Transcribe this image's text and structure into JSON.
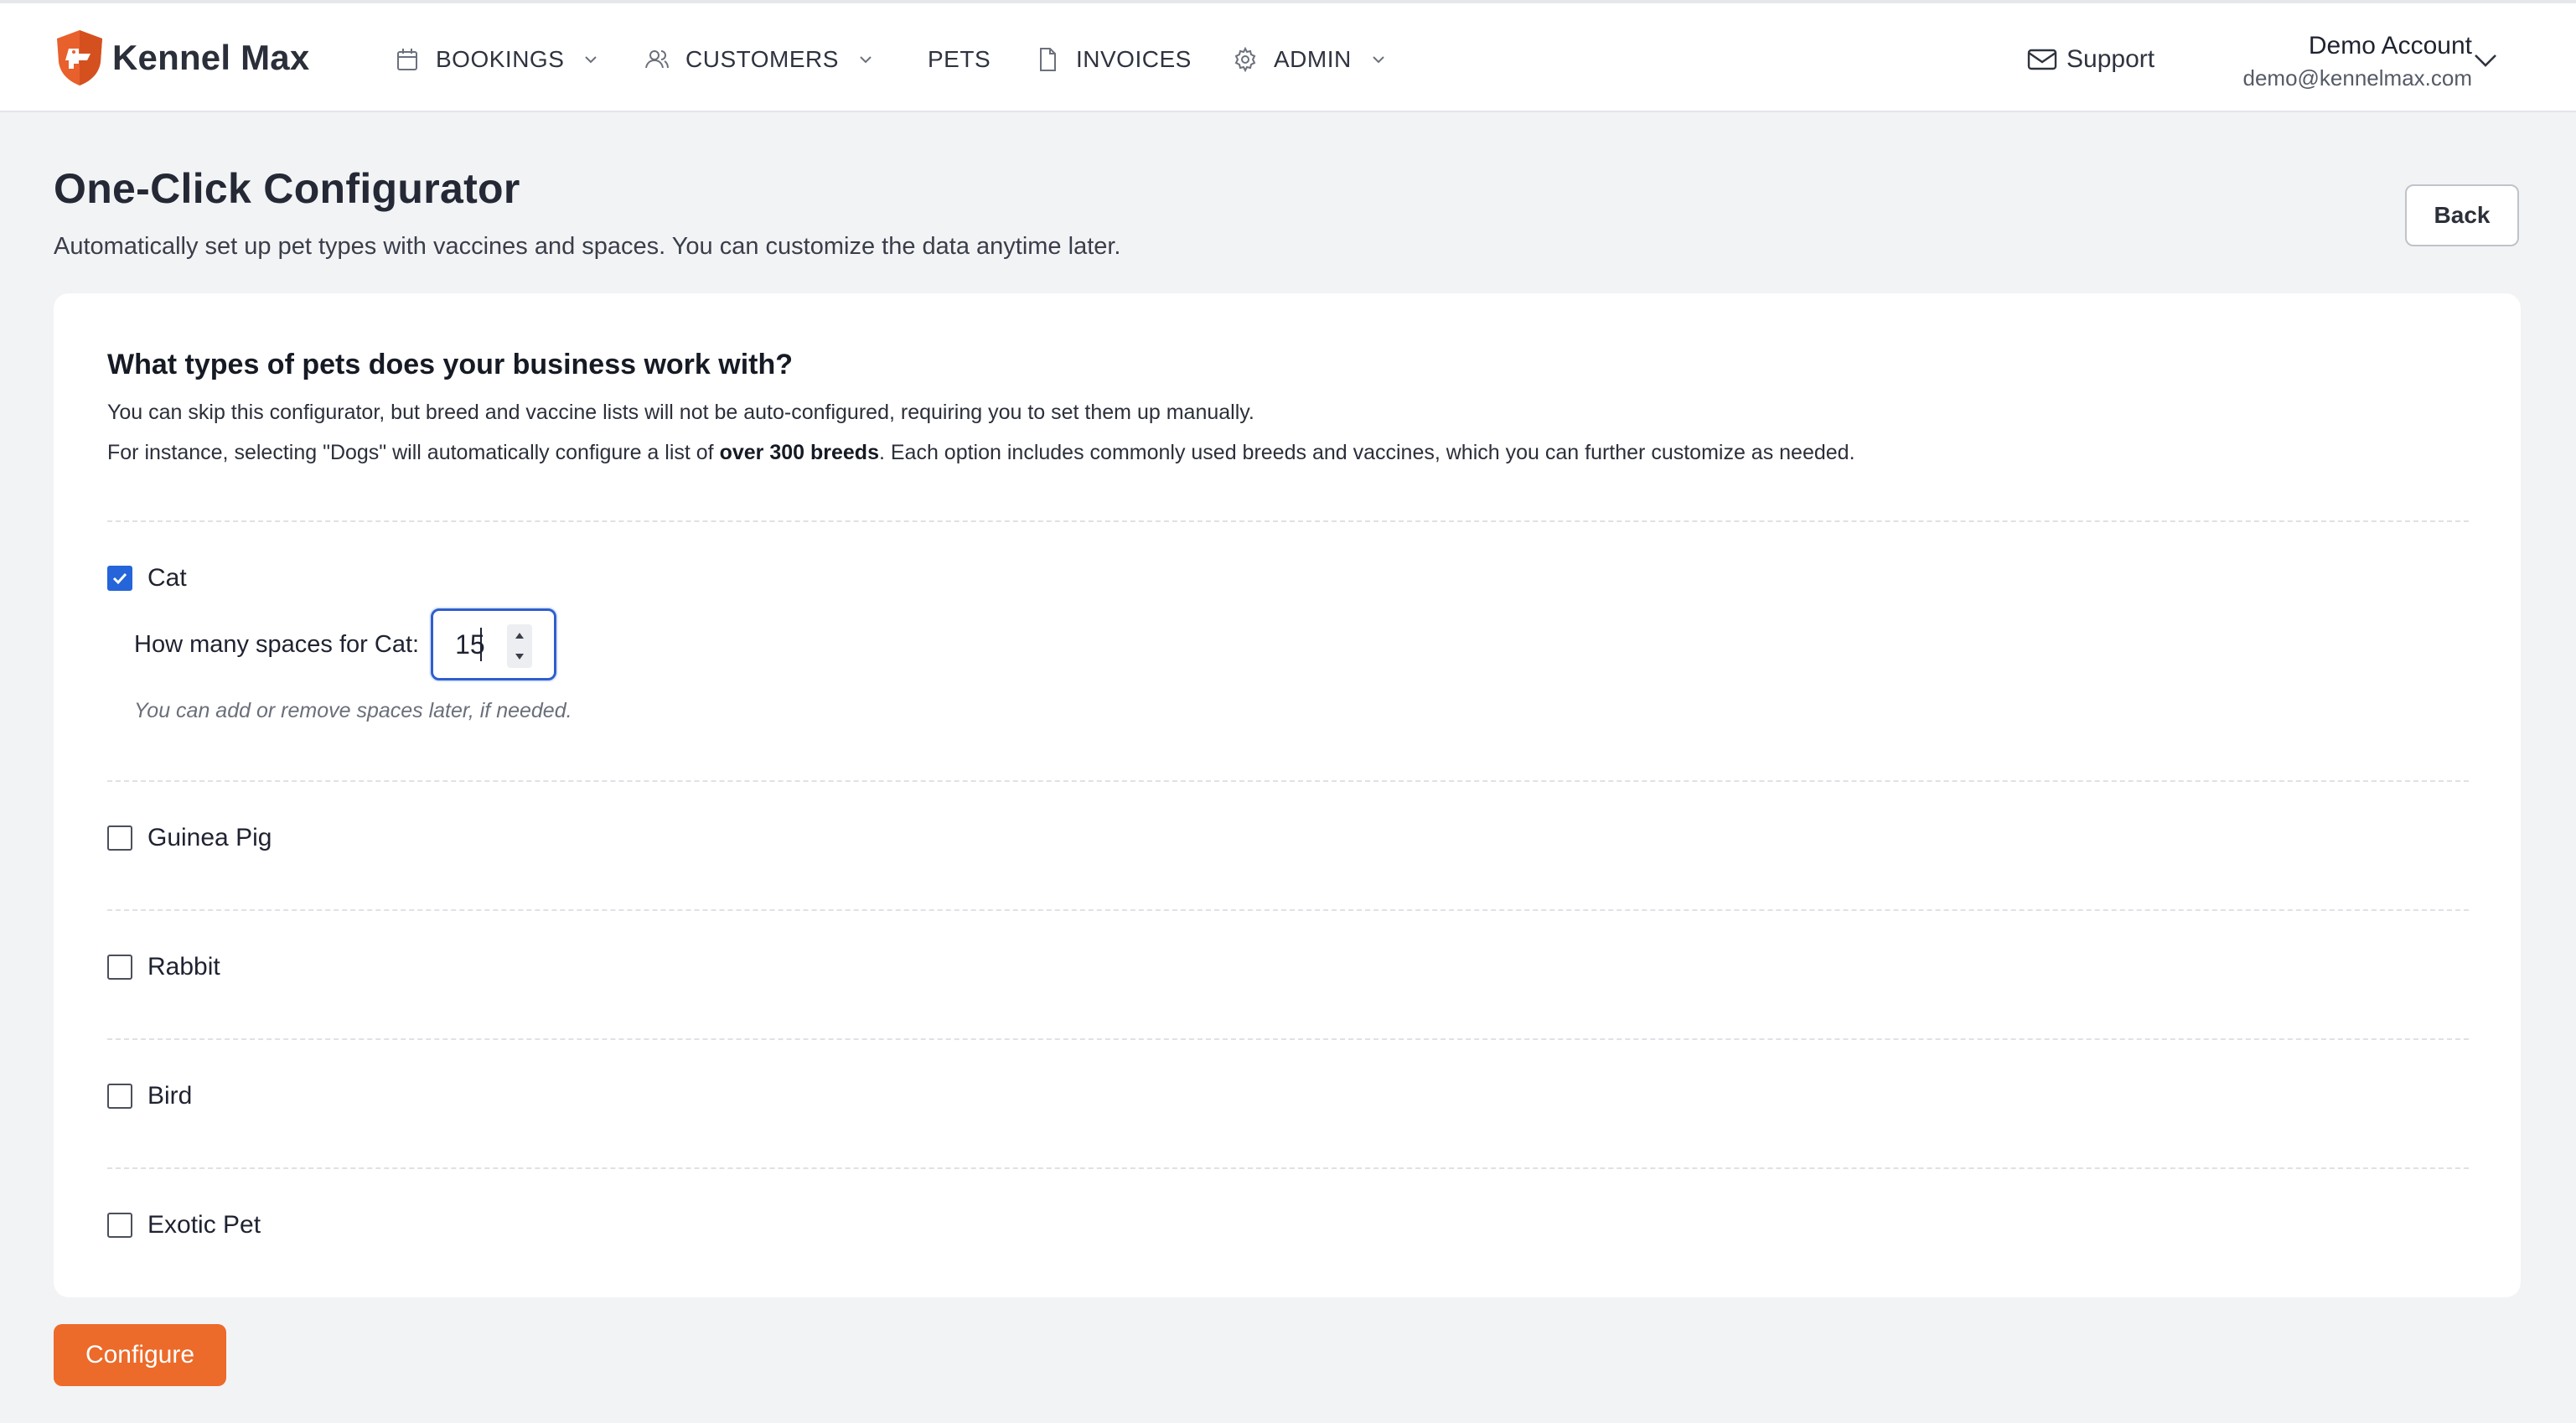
{
  "app": {
    "logo_text": "Kennel Max"
  },
  "nav": {
    "bookings": "BOOKINGS",
    "customers": "CUSTOMERS",
    "pets": "PETS",
    "invoices": "INVOICES",
    "admin": "ADMIN",
    "support": "Support"
  },
  "account": {
    "name": "Demo Account",
    "email": "demo@kennelmax.com"
  },
  "page": {
    "title": "One-Click Configurator",
    "subtitle": "Automatically set up pet types with vaccines and spaces. You can customize the data anytime later.",
    "back_label": "Back"
  },
  "question": {
    "title": "What types of pets does your business work with?",
    "line1": "You can skip this configurator, but breed and vaccine lists will not be auto-configured, requiring you to set them up manually.",
    "line2_prefix": "For instance, selecting \"Dogs\" will automatically configure a list of ",
    "line2_bold": "over 300 breeds",
    "line2_suffix": ". Each option includes commonly used breeds and vaccines, which you can further customize as needed."
  },
  "pets": [
    {
      "label": "Cat",
      "checked": true
    },
    {
      "label": "Guinea Pig",
      "checked": false
    },
    {
      "label": "Rabbit",
      "checked": false
    },
    {
      "label": "Bird",
      "checked": false
    },
    {
      "label": "Exotic Pet",
      "checked": false
    }
  ],
  "spaces": {
    "label": "How many spaces for Cat:",
    "value": "15",
    "hint": "You can add or remove spaces later, if needed."
  },
  "configure_label": "Configure",
  "colors": {
    "brand_orange": "#ec6a2a",
    "checkbox_blue": "#2564d9",
    "focus_border": "#2e5fce"
  }
}
